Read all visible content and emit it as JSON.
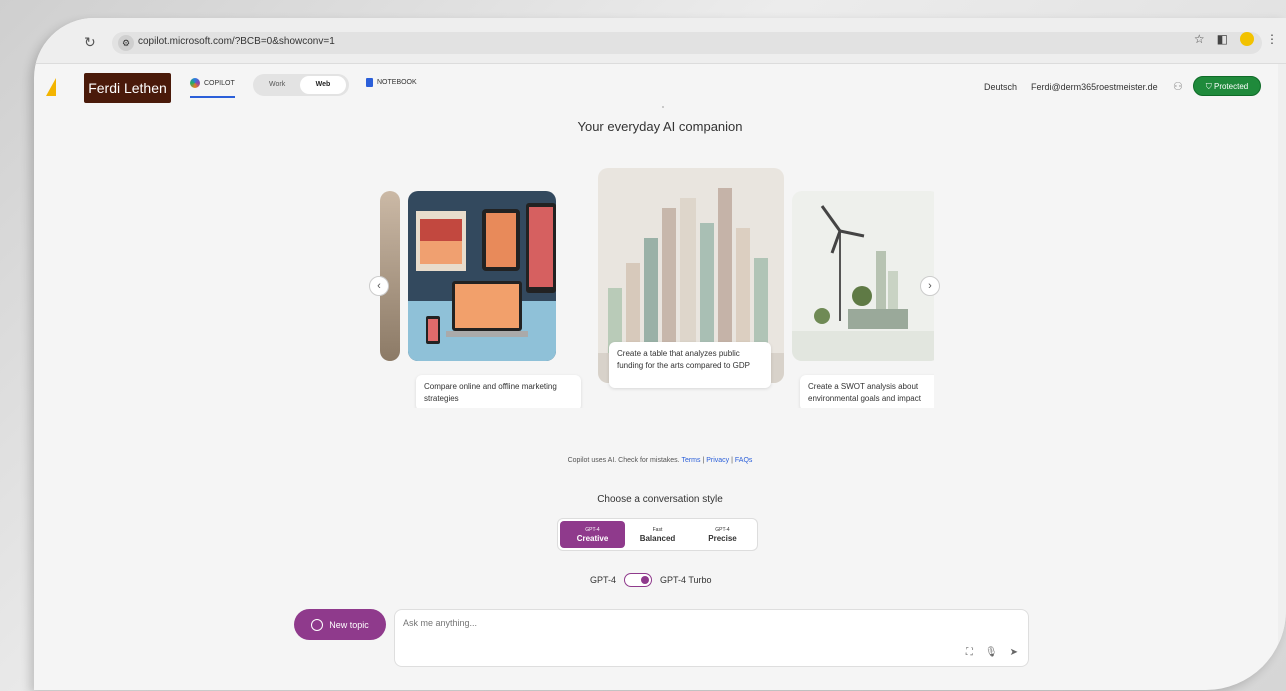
{
  "browser": {
    "url": "copilot.microsoft.com/?BCB=0&showconv=1",
    "icons": [
      "reload-icon",
      "site-settings-icon",
      "star-icon",
      "sidebar-icon",
      "profile-icon",
      "menu-icon"
    ]
  },
  "header": {
    "user_name": "Ferdi Lethen",
    "tabs": {
      "copilot": "COPILOT",
      "notebook": "NOTEBOOK"
    },
    "mode_toggle": {
      "work": "Work",
      "web": "Web",
      "selected": "Web"
    },
    "language": "Deutsch",
    "email": "Ferdi@derm365roestmeister.de",
    "protected_label": "Protected"
  },
  "main": {
    "tagline": "Your everyday AI companion",
    "cards": [
      {
        "caption": "Compare online and offline marketing strategies"
      },
      {
        "caption": "Create a table that analyzes public funding for the arts compared to GDP"
      },
      {
        "caption": "Create a SWOT analysis about environmental goals and impact"
      }
    ],
    "disclaimer": {
      "text": "Copilot uses AI. Check for mistakes.",
      "terms": "Terms",
      "privacy": "Privacy",
      "faqs": "FAQs"
    },
    "conversation_style": {
      "title": "Choose a conversation style",
      "options": [
        {
          "sub": "GPT-4",
          "label": "Creative"
        },
        {
          "sub": "Fast",
          "label": "Balanced"
        },
        {
          "sub": "GPT-4",
          "label": "Precise"
        }
      ],
      "selected": "Creative"
    },
    "model_switch": {
      "left": "GPT-4",
      "right": "GPT-4 Turbo",
      "selected": "GPT-4 Turbo"
    },
    "new_topic": "New topic",
    "input_placeholder": "Ask me anything..."
  },
  "colors": {
    "accent": "#8f3a8c",
    "protected": "#1f8a3b",
    "user_badge": "#4a1a0a",
    "link": "#2b5fd9"
  }
}
